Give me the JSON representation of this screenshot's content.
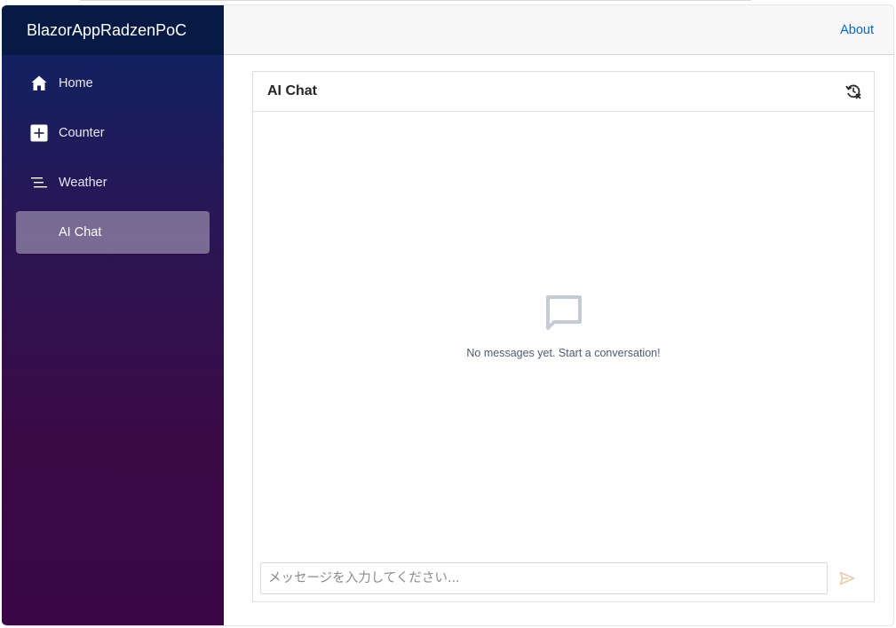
{
  "app": {
    "title": "BlazorAppRadzenPoC"
  },
  "sidebar": {
    "items": [
      {
        "label": "Home",
        "icon": "home-icon",
        "active": false
      },
      {
        "label": "Counter",
        "icon": "plus-square-icon",
        "active": false
      },
      {
        "label": "Weather",
        "icon": "list-icon",
        "active": false
      },
      {
        "label": "AI Chat",
        "icon": "",
        "active": true
      }
    ]
  },
  "topbar": {
    "about_label": "About"
  },
  "chat": {
    "title": "AI Chat",
    "reset_icon": "history-clear-icon",
    "empty_icon": "chat-bubble-icon",
    "empty_text": "No messages yet. Start a conversation!",
    "input_placeholder": "メッセージを入力してください...",
    "input_value": "",
    "send_icon": "send-icon"
  },
  "colors": {
    "brand_bar": "#061a43",
    "sidebar_top": "#0b2565",
    "sidebar_bottom": "#3a0646",
    "link": "#0366d6",
    "send_disabled": "#f3c9a5"
  }
}
